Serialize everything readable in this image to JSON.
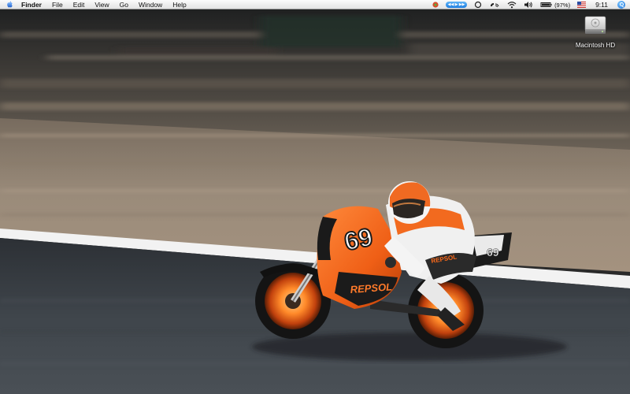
{
  "menubar": {
    "apple_menu": "apple-menu",
    "app_name": "Finder",
    "items": [
      "File",
      "Edit",
      "View",
      "Go",
      "Window",
      "Help"
    ],
    "status": {
      "battery_percent": "(97%)",
      "clock": "9:11"
    }
  },
  "desktop": {
    "icons": [
      {
        "label": "Macintosh HD",
        "icon": "hard-drive-icon"
      }
    ]
  },
  "colors": {
    "track_asphalt": "#3f4449",
    "track_line": "#f2f2f2",
    "bike_orange": "#f0661c",
    "spotlight_blue": "#1f7fe0"
  }
}
